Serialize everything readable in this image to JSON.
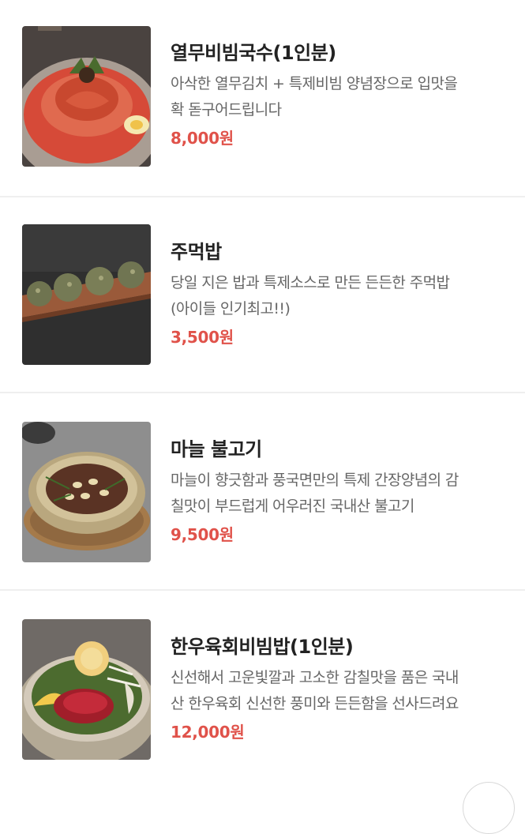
{
  "menu": {
    "items": [
      {
        "name": "열무비빔국수(1인분)",
        "desc_lines": [
          "아삭한 열무김치 + 특제비빔 양념장으로 입맛을",
          "확 돋구어드립니다"
        ],
        "price": "8,000원",
        "photo": "bibim-noodles-photo"
      },
      {
        "name": "주먹밥",
        "desc_lines": [
          "당일 지은 밥과 특제소스로 만든 든든한 주먹밥",
          "(아이들 인기최고!!)"
        ],
        "price": "3,500원",
        "photo": "rice-ball-photo"
      },
      {
        "name": "마늘 불고기",
        "desc_lines": [
          "마늘이 향긋함과 풍국면만의 특제 간장양념의 감",
          "칠맛이 부드럽게 어우러진 국내산 불고기"
        ],
        "price": "9,500원",
        "photo": "garlic-bulgogi-photo"
      },
      {
        "name": "한우육회비빔밥(1인분)",
        "desc_lines": [
          "신선해서 고운빛깔과 고소한 감칠맛을 품은 국내",
          "산 한우육회 신선한 풍미와 든든함을 선사드려요"
        ],
        "price": "12,000원",
        "photo": "beef-tartare-bibimbap-photo"
      }
    ]
  },
  "colors": {
    "price": "#e0524a",
    "name": "#222222",
    "desc": "#666666",
    "divider": "#efefef"
  }
}
